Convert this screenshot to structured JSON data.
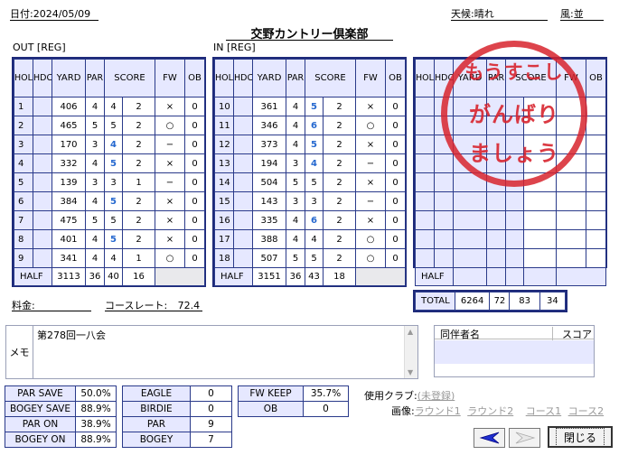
{
  "header": {
    "date_label": "日付:",
    "date": "2024/05/09",
    "title": "交野カントリー倶楽部",
    "weather_label": "天候:",
    "weather": "晴れ",
    "wind_label": "風:",
    "wind": "並"
  },
  "cols": {
    "hole": "HOLE",
    "hdcp": "HDCP",
    "yard": "YARD",
    "par": "PAR",
    "score": "SCORE",
    "fw": "FW",
    "ob": "OB"
  },
  "out": {
    "label": "OUT [REG]",
    "rows": [
      {
        "hole": "1",
        "yard": "406",
        "par": "4",
        "score": "4",
        "putt": "2",
        "fw": "×",
        "ob": "0",
        "blue": false
      },
      {
        "hole": "2",
        "yard": "465",
        "par": "5",
        "score": "5",
        "putt": "2",
        "fw": "○",
        "ob": "0",
        "blue": false
      },
      {
        "hole": "3",
        "yard": "170",
        "par": "3",
        "score": "4",
        "putt": "2",
        "fw": "−",
        "ob": "0",
        "blue": true
      },
      {
        "hole": "4",
        "yard": "332",
        "par": "4",
        "score": "5",
        "putt": "2",
        "fw": "×",
        "ob": "0",
        "blue": true
      },
      {
        "hole": "5",
        "yard": "139",
        "par": "3",
        "score": "3",
        "putt": "1",
        "fw": "−",
        "ob": "0",
        "blue": false
      },
      {
        "hole": "6",
        "yard": "384",
        "par": "4",
        "score": "5",
        "putt": "2",
        "fw": "×",
        "ob": "0",
        "blue": true
      },
      {
        "hole": "7",
        "yard": "475",
        "par": "5",
        "score": "5",
        "putt": "2",
        "fw": "×",
        "ob": "0",
        "blue": false
      },
      {
        "hole": "8",
        "yard": "401",
        "par": "4",
        "score": "5",
        "putt": "2",
        "fw": "×",
        "ob": "0",
        "blue": true
      },
      {
        "hole": "9",
        "yard": "341",
        "par": "4",
        "score": "4",
        "putt": "1",
        "fw": "○",
        "ob": "0",
        "blue": false
      }
    ],
    "half": {
      "label": "HALF",
      "yard": "3113",
      "par": "36",
      "score": "40",
      "putt": "16"
    }
  },
  "in": {
    "label": "IN [REG]",
    "rows": [
      {
        "hole": "10",
        "yard": "361",
        "par": "4",
        "score": "5",
        "putt": "2",
        "fw": "×",
        "ob": "0",
        "blue": true
      },
      {
        "hole": "11",
        "yard": "346",
        "par": "4",
        "score": "6",
        "putt": "2",
        "fw": "○",
        "ob": "0",
        "blue": true
      },
      {
        "hole": "12",
        "yard": "373",
        "par": "4",
        "score": "5",
        "putt": "2",
        "fw": "×",
        "ob": "0",
        "blue": true
      },
      {
        "hole": "13",
        "yard": "194",
        "par": "3",
        "score": "4",
        "putt": "2",
        "fw": "−",
        "ob": "0",
        "blue": true
      },
      {
        "hole": "14",
        "yard": "504",
        "par": "5",
        "score": "5",
        "putt": "2",
        "fw": "×",
        "ob": "0",
        "blue": false
      },
      {
        "hole": "15",
        "yard": "143",
        "par": "3",
        "score": "3",
        "putt": "2",
        "fw": "−",
        "ob": "0",
        "blue": false
      },
      {
        "hole": "16",
        "yard": "335",
        "par": "4",
        "score": "6",
        "putt": "2",
        "fw": "×",
        "ob": "0",
        "blue": true
      },
      {
        "hole": "17",
        "yard": "388",
        "par": "4",
        "score": "4",
        "putt": "2",
        "fw": "○",
        "ob": "0",
        "blue": false
      },
      {
        "hole": "18",
        "yard": "507",
        "par": "5",
        "score": "5",
        "putt": "2",
        "fw": "○",
        "ob": "0",
        "blue": false
      }
    ],
    "half": {
      "label": "HALF",
      "yard": "3151",
      "par": "36",
      "score": "43",
      "putt": "18"
    }
  },
  "extra": {
    "half_label": "HALF",
    "total_label": "TOTAL",
    "total_yard": "6264",
    "total_par": "72",
    "total_score": "83",
    "total_putt": "34"
  },
  "stamp": {
    "line1": "もうすこし",
    "line2": "がんばり",
    "line3": "ましょう",
    "color": "#d7232d"
  },
  "fee": {
    "label": "料金:",
    "value": ""
  },
  "course_rate": {
    "label": "コースレート:",
    "value": "72.4"
  },
  "memo": {
    "label": "メモ",
    "text": "第278回一八会"
  },
  "companions": {
    "name_col": "同伴者名",
    "score_col": "スコア"
  },
  "stats1": [
    {
      "label": "PAR SAVE",
      "value": "50.0%"
    },
    {
      "label": "BOGEY SAVE",
      "value": "88.9%"
    },
    {
      "label": "PAR ON",
      "value": "38.9%"
    },
    {
      "label": "BOGEY ON",
      "value": "88.9%"
    }
  ],
  "stats2": [
    {
      "label": "EAGLE",
      "value": "0"
    },
    {
      "label": "BIRDIE",
      "value": "0"
    },
    {
      "label": "PAR",
      "value": "9"
    },
    {
      "label": "BOGEY",
      "value": "7"
    }
  ],
  "stats3": [
    {
      "label": "FW KEEP",
      "value": "35.7%"
    },
    {
      "label": "OB",
      "value": "0"
    }
  ],
  "clubs": {
    "label": "使用クラブ:",
    "link": "(未登録)"
  },
  "images": {
    "label": "画像:",
    "round1": "ラウンド1",
    "round2": "ラウンド2",
    "course1": "コース1",
    "course2": "コース2"
  },
  "buttons": {
    "close": "閉じる"
  },
  "colors": {
    "border": "#2a3a8a",
    "header_bg": "#e6e8ff",
    "score_blue": "#2568cf"
  }
}
